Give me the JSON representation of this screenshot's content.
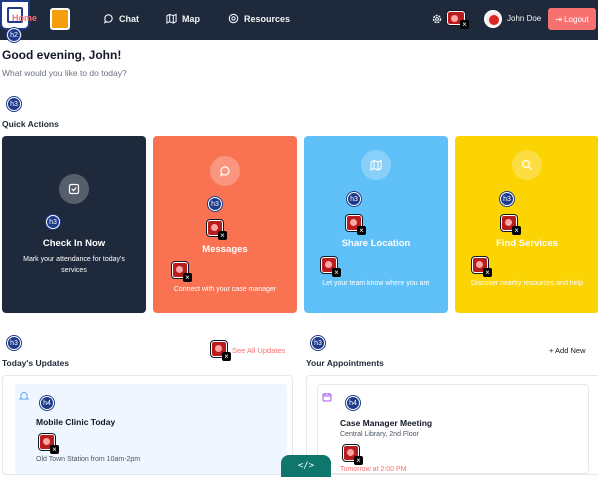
{
  "nav": {
    "home_label": "Home",
    "items": [
      {
        "label": "Chat",
        "icon": "chat-icon"
      },
      {
        "label": "Map",
        "icon": "map-icon"
      },
      {
        "label": "Resources",
        "icon": "resources-icon"
      }
    ],
    "user_name": "John Doe",
    "logout_label": "Logout"
  },
  "markers": {
    "h2": "h2",
    "h3": "h3",
    "h4": "h4"
  },
  "greeting": {
    "title": "Good evening, John!",
    "subtitle": "What would you like to do today?"
  },
  "quick_actions": {
    "title": "Quick Actions",
    "cards": [
      {
        "title": "Check In Now",
        "desc": "Mark your attendance for today's services",
        "color": "#1e293b",
        "icon": "check-square-icon"
      },
      {
        "title": "Messages",
        "desc": "Connect with your case manager",
        "color": "#f97352",
        "icon": "message-icon"
      },
      {
        "title": "Share Location",
        "desc": "Let your team know where you are",
        "color": "#60c0f8",
        "icon": "map-icon"
      },
      {
        "title": "Find Services",
        "desc": "Discover nearby resources and help",
        "color": "#fcd303",
        "icon": "search-icon"
      }
    ]
  },
  "updates": {
    "title": "Today's Updates",
    "see_all": "See All Updates",
    "item_title": "Mobile Clinic Today",
    "item_sub": "Old Town Station from 10am-2pm"
  },
  "appointments": {
    "title": "Your Appointments",
    "add_new": "+ Add New",
    "item_title": "Case Manager Meeting",
    "item_sub": "Central Library, 2nd Floor",
    "item_time": "Tomorrow at 2:00 PM"
  },
  "code_badge": "</>"
}
